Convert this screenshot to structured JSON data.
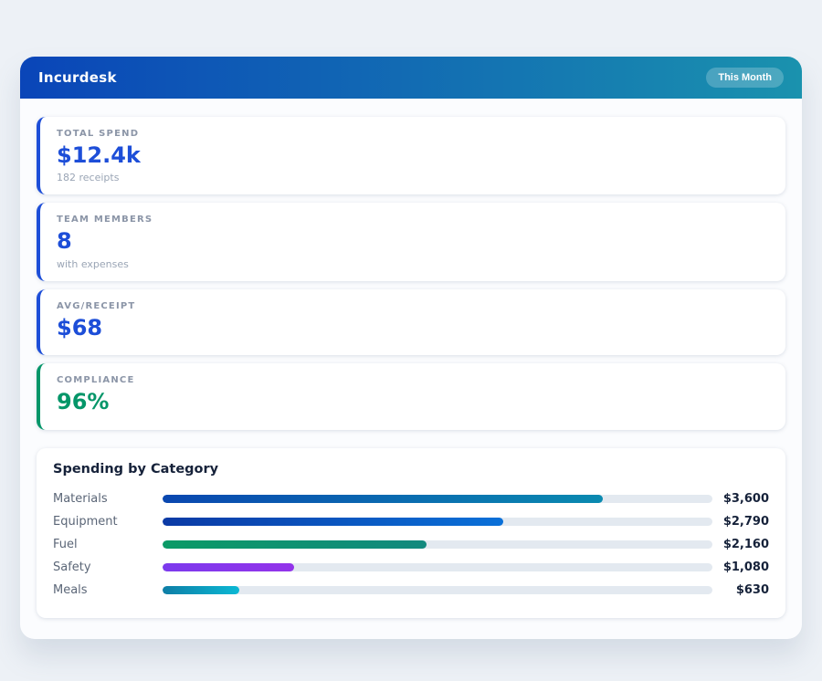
{
  "header": {
    "title": "Incurdesk",
    "badge": "This Month",
    "gradient_from": "#0a45b8",
    "gradient_to": "#1a92ae"
  },
  "stats": [
    {
      "label": "TOTAL SPEND",
      "value": "$12.4k",
      "sub": "182 receipts",
      "color": "#1d4ed8"
    },
    {
      "label": "TEAM MEMBERS",
      "value": "8",
      "sub": "with expenses",
      "color": "#1d4ed8"
    },
    {
      "label": "AVG/RECEIPT",
      "value": "$68",
      "sub": "",
      "color": "#1d4ed8"
    },
    {
      "label": "COMPLIANCE",
      "value": "96%",
      "sub": "",
      "color": "#059669"
    }
  ],
  "chart_data": {
    "type": "bar",
    "orientation": "horizontal",
    "title": "Spending by Category",
    "categories": [
      "Materials",
      "Equipment",
      "Fuel",
      "Safety",
      "Meals"
    ],
    "values": [
      3600,
      2790,
      2160,
      1080,
      630
    ],
    "scale_max": 4500,
    "track_color": "#e3e9f0",
    "rows": [
      {
        "label": "Materials",
        "value": 3600,
        "value_label": "$3,600",
        "color_from": "#0a47b0",
        "color_to": "#0a8ab0"
      },
      {
        "label": "Equipment",
        "value": 2790,
        "value_label": "$2,790",
        "color_from": "#0b3aa5",
        "color_to": "#0a70d8"
      },
      {
        "label": "Fuel",
        "value": 2160,
        "value_label": "$2,160",
        "color_from": "#0b9a66",
        "color_to": "#12897e"
      },
      {
        "label": "Safety",
        "value": 1080,
        "value_label": "$1,080",
        "color_from": "#7c3aed",
        "color_to": "#9333ea"
      },
      {
        "label": "Meals",
        "value": 630,
        "value_label": "$630",
        "color_from": "#0e7ea6",
        "color_to": "#0bb8d4"
      }
    ]
  }
}
